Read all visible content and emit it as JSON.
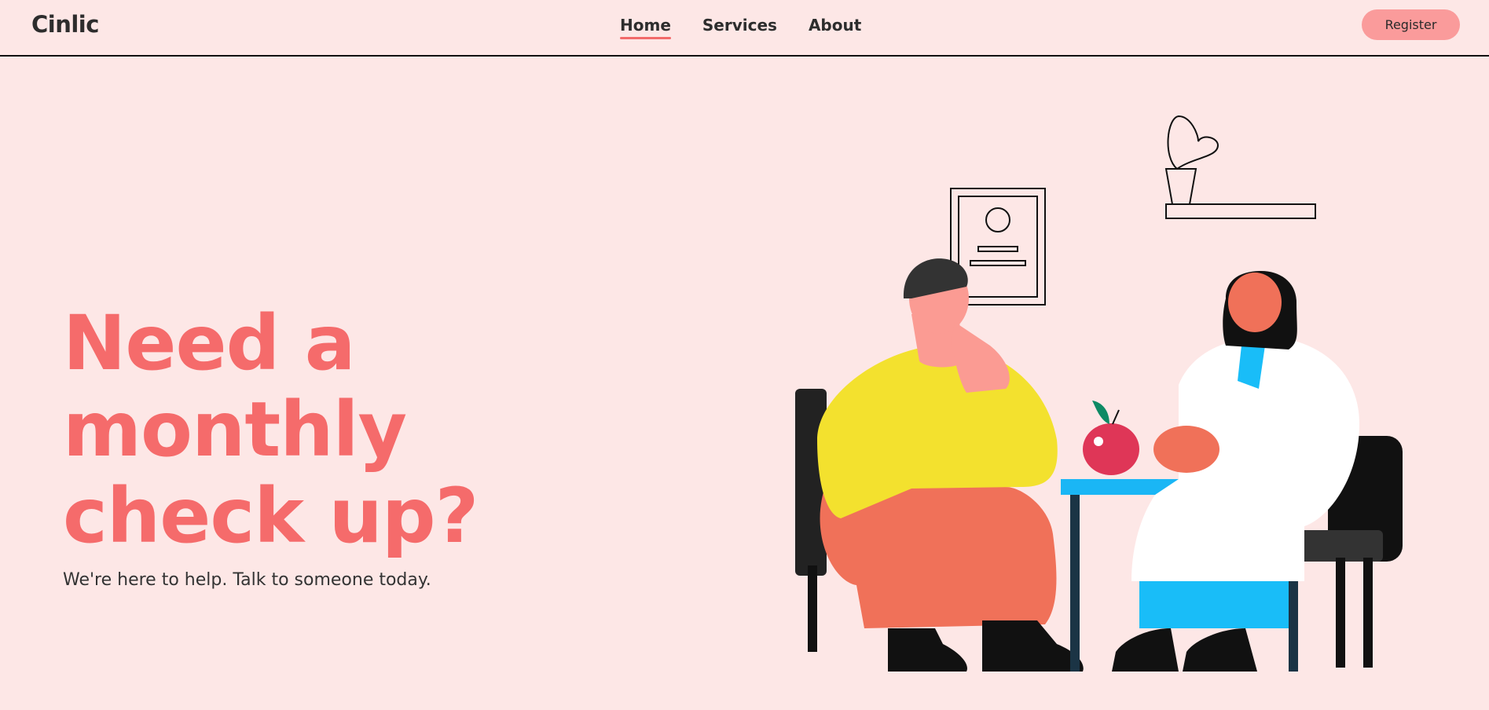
{
  "header": {
    "brand": "Cinlic",
    "nav": [
      {
        "label": "Home",
        "active": true
      },
      {
        "label": "Services",
        "active": false
      },
      {
        "label": "About",
        "active": false
      }
    ],
    "register_label": "Register"
  },
  "hero": {
    "title_lines": [
      "Need a",
      "monthly",
      "check up?"
    ],
    "subtitle": "We're here to help. Talk to someone today."
  },
  "colors": {
    "background": "#fde7e6",
    "accent": "#f56b6b",
    "button": "#fa9b9b",
    "sweater": "#f3e12e",
    "pants": "#f07159",
    "table": "#1ab6f5"
  },
  "illustration": {
    "icons": [
      "doctor-consultation-illustration",
      "plant-icon",
      "certificate-frame-icon",
      "apple-icon"
    ]
  }
}
